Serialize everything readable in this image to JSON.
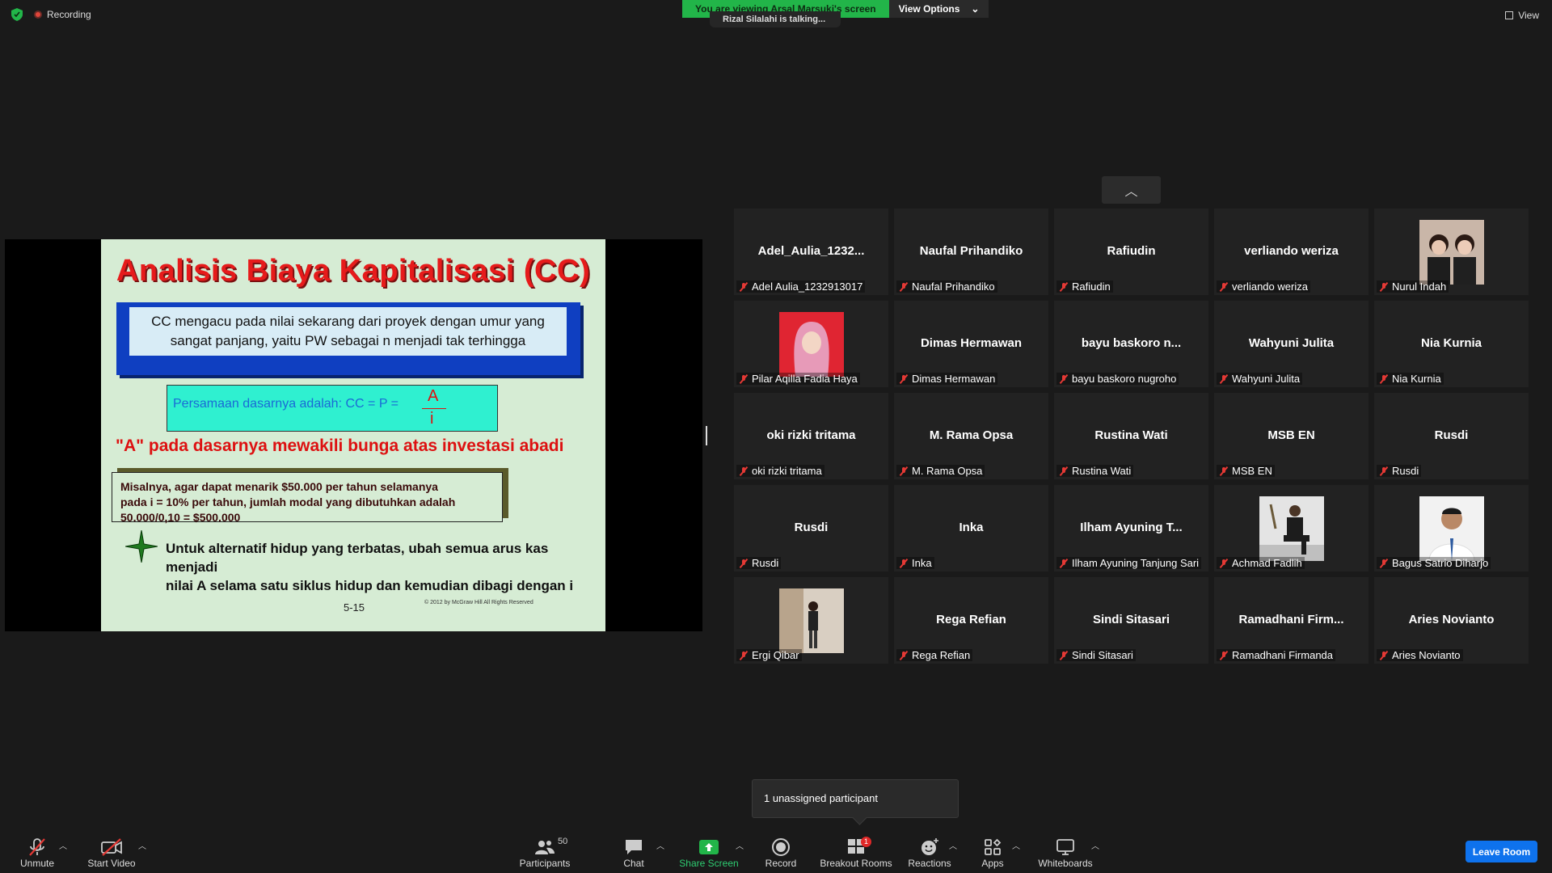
{
  "top": {
    "recording_label": "Recording",
    "banner_text": "You are viewing Arsal Marsuki's screen",
    "view_options_label": "View Options",
    "talking_text": "Rizal Silalahi is talking...",
    "view_label": "View"
  },
  "slide": {
    "title": "Analisis Biaya Kapitalisasi (CC)",
    "definition_line1": "CC mengacu pada nilai sekarang dari proyek dengan umur yang",
    "definition_line2": "sangat panjang, yaitu PW sebagai n menjadi tak terhingga",
    "equation": "Persamaan dasarnya adalah: CC = P =",
    "frac_num": "A",
    "frac_den": "i",
    "red_statement": "\"A\" pada dasarnya mewakili bunga atas investasi abadi",
    "example_line1": "Misalnya, agar dapat menarik $50.000 per tahun selamanya",
    "example_line2": "pada i = 10% per tahun, jumlah modal yang dibutuhkan adalah 50.000/0,10 = $500.000",
    "bullet_line1": "Untuk alternatif hidup yang terbatas, ubah semua arus kas menjadi",
    "bullet_line2": "nilai A selama satu siklus hidup dan kemudian dibagi dengan i",
    "slide_number": "5-15",
    "copyright": "© 2012 by McGraw Hill    All Rights Reserved"
  },
  "gallery": {
    "collapse_icon": "chevron-up-icon",
    "tiles": [
      {
        "display": "Adel_Aulia_1232...",
        "name": "Adel Aulia_1232913017",
        "photo": ""
      },
      {
        "display": "Naufal Prihandiko",
        "name": "Naufal Prihandiko",
        "photo": ""
      },
      {
        "display": "Rafiudin",
        "name": "Rafiudin",
        "photo": ""
      },
      {
        "display": "verliando weriza",
        "name": "verliando weriza",
        "photo": ""
      },
      {
        "display": "",
        "name": "Nurul Indah",
        "photo": "two-people"
      },
      {
        "display": "",
        "name": "Pilar Aqilla Fadia Haya",
        "photo": "hijab"
      },
      {
        "display": "Dimas Hermawan",
        "name": "Dimas Hermawan",
        "photo": ""
      },
      {
        "display": "bayu baskoro n...",
        "name": "bayu baskoro nugroho",
        "photo": ""
      },
      {
        "display": "Wahyuni Julita",
        "name": "Wahyuni Julita",
        "photo": ""
      },
      {
        "display": "Nia Kurnia",
        "name": "Nia Kurnia",
        "photo": ""
      },
      {
        "display": "oki rizki tritama",
        "name": "oki rizki tritama",
        "photo": ""
      },
      {
        "display": "M. Rama Opsa",
        "name": "M. Rama Opsa",
        "photo": ""
      },
      {
        "display": "Rustina Wati",
        "name": "Rustina Wati",
        "photo": ""
      },
      {
        "display": "MSB EN",
        "name": "MSB EN",
        "photo": ""
      },
      {
        "display": "Rusdi",
        "name": "Rusdi",
        "photo": ""
      },
      {
        "display": "Rusdi",
        "name": "Rusdi",
        "photo": ""
      },
      {
        "display": "Inka",
        "name": "Inka",
        "photo": ""
      },
      {
        "display": "Ilham Ayuning T...",
        "name": "Ilham Ayuning Tanjung Sari",
        "photo": ""
      },
      {
        "display": "",
        "name": "Achmad Fadlih",
        "photo": "suit-seated"
      },
      {
        "display": "",
        "name": "Bagus Satrio Diharjo",
        "photo": "white-shirt"
      },
      {
        "display": "",
        "name": "Ergi Qibar",
        "photo": "standing"
      },
      {
        "display": "Rega Refian",
        "name": "Rega Refian",
        "photo": ""
      },
      {
        "display": "Sindi Sitasari",
        "name": "Sindi Sitasari",
        "photo": ""
      },
      {
        "display": "Ramadhani  Firm...",
        "name": "Ramadhani Firmanda",
        "photo": ""
      },
      {
        "display": "Aries Novianto",
        "name": "Aries Novianto",
        "photo": ""
      }
    ]
  },
  "tooltip": "1 unassigned participant",
  "toolbar": {
    "unmute": "Unmute",
    "start_video": "Start Video",
    "participants": "Participants",
    "participants_count": "50",
    "chat": "Chat",
    "share_screen": "Share Screen",
    "record": "Record",
    "breakout_rooms": "Breakout Rooms",
    "breakout_badge": "1",
    "reactions": "Reactions",
    "apps": "Apps",
    "whiteboards": "Whiteboards",
    "leave_room": "Leave Room"
  },
  "colors": {
    "accent_green": "#22b549",
    "leave_blue": "#0e72ed",
    "mute_red": "#e53935"
  }
}
